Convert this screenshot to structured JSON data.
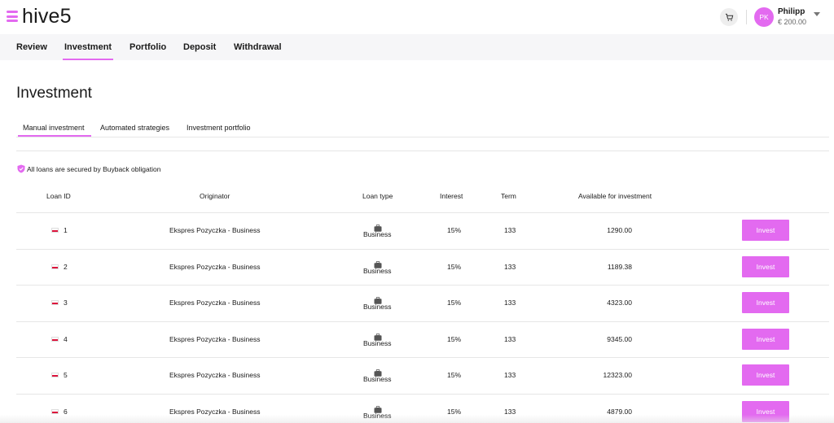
{
  "header": {
    "logo_text": "hive5",
    "user": {
      "initials": "PK",
      "name": "Philipp",
      "balance": "€ 200.00"
    },
    "icons": {
      "menu": "menu-bars-icon",
      "cart": "cart-icon",
      "caret": "chevron-down-icon"
    }
  },
  "nav": {
    "items": [
      {
        "label": "Review"
      },
      {
        "label": "Investment",
        "active": true
      },
      {
        "label": "Portfolio"
      },
      {
        "label": "Deposit"
      },
      {
        "label": "Withdrawal"
      }
    ]
  },
  "page": {
    "title": "Investment"
  },
  "subtabs": [
    {
      "label": "Manual investment",
      "active": true
    },
    {
      "label": "Automated strategies"
    },
    {
      "label": "Investment portfolio"
    }
  ],
  "notice": {
    "text": "All loans are secured by Buyback obligation"
  },
  "table": {
    "headers": {
      "loan_id": "Loan ID",
      "originator": "Originator",
      "loan_type": "Loan type",
      "interest": "Interest",
      "term": "Term",
      "available": "Available for investment"
    },
    "rows": [
      {
        "id": "1",
        "originator": "Ekspres Pozyczka - Business",
        "type": "Business",
        "interest": "15%",
        "term": "133",
        "available": "1290.00",
        "action": "Invest"
      },
      {
        "id": "2",
        "originator": "Ekspres Pozyczka - Business",
        "type": "Business",
        "interest": "15%",
        "term": "133",
        "available": "1189.38",
        "action": "Invest"
      },
      {
        "id": "3",
        "originator": "Ekspres Pozyczka - Business",
        "type": "Business",
        "interest": "15%",
        "term": "133",
        "available": "4323.00",
        "action": "Invest"
      },
      {
        "id": "4",
        "originator": "Ekspres Pozyczka - Business",
        "type": "Business",
        "interest": "15%",
        "term": "133",
        "available": "9345.00",
        "action": "Invest"
      },
      {
        "id": "5",
        "originator": "Ekspres Pozyczka - Business",
        "type": "Business",
        "interest": "15%",
        "term": "133",
        "available": "12323.00",
        "action": "Invest"
      },
      {
        "id": "6",
        "originator": "Ekspres Pozyczka - Business",
        "type": "Business",
        "interest": "15%",
        "term": "133",
        "available": "4879.00",
        "action": "Invest"
      }
    ]
  },
  "colors": {
    "accent": "#e36af0",
    "nav_bg": "#f6f6f8",
    "flag_red": "#dc143c"
  }
}
